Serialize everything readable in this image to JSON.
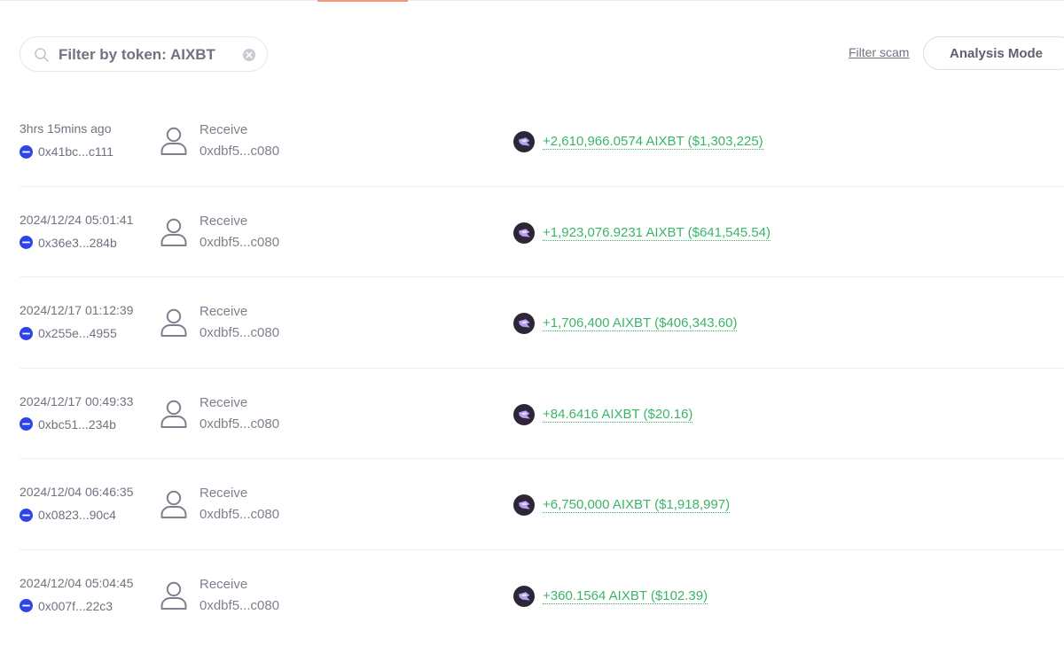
{
  "filter": {
    "search_text": "Filter by token: AIXBT",
    "filter_scam_label": "Filter scam",
    "analysis_mode_label": "Analysis Mode"
  },
  "colors": {
    "tab_accent": "#ee9a7e",
    "amount_green": "#3bb46a",
    "chain_blue": "#2d44e8"
  },
  "transactions": [
    {
      "time": "3hrs 15mins ago",
      "hash": "0x41bc...c111",
      "type": "Receive",
      "counterparty": "0xdbf5...c080",
      "amount": "+2,610,966.0574 AIXBT ($1,303,225)"
    },
    {
      "time": "2024/12/24 05:01:41",
      "hash": "0x36e3...284b",
      "type": "Receive",
      "counterparty": "0xdbf5...c080",
      "amount": "+1,923,076.9231 AIXBT ($641,545.54)"
    },
    {
      "time": "2024/12/17 01:12:39",
      "hash": "0x255e...4955",
      "type": "Receive",
      "counterparty": "0xdbf5...c080",
      "amount": "+1,706,400 AIXBT ($406,343.60)"
    },
    {
      "time": "2024/12/17 00:49:33",
      "hash": "0xbc51...234b",
      "type": "Receive",
      "counterparty": "0xdbf5...c080",
      "amount": "+84.6416 AIXBT ($20.16)"
    },
    {
      "time": "2024/12/04 06:46:35",
      "hash": "0x0823...90c4",
      "type": "Receive",
      "counterparty": "0xdbf5...c080",
      "amount": "+6,750,000 AIXBT ($1,918,997)"
    },
    {
      "time": "2024/12/04 05:04:45",
      "hash": "0x007f...22c3",
      "type": "Receive",
      "counterparty": "0xdbf5...c080",
      "amount": "+360.1564 AIXBT ($102.39)"
    }
  ]
}
